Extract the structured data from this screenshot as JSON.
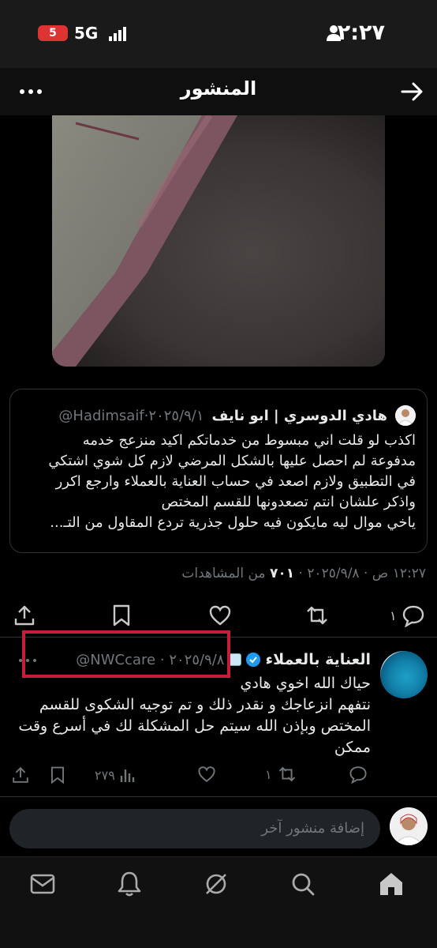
{
  "status_bar": {
    "time": "٢:٢٧",
    "network": "5G",
    "battery": "5"
  },
  "header": {
    "title": "المنشور"
  },
  "quoted_post": {
    "display_name": "هادي الدوسري | ابو نايف",
    "handle_date": "@Hadimsaif·٢٠٢٥/٩/١",
    "lines": [
      "اكذب لو قلت اني مبسوط من خدماتكم اكيد منزعج خدمه",
      "مدفوعة لم احصل عليها بالشكل المرضي لازم كل شوي اشتكي",
      "في التطبيق ولازم اصعد في حساب العناية بالعملاء وارجع اكرر",
      "واذكر علشان انتم تصعدونها للقسم المختص",
      "ياخي موال ليه مايكون فيه حلول جذرية تردع المقاول من التـ..."
    ]
  },
  "post_meta": {
    "time_date": "١٢:٢٧ ص · ٢٠٢٥/٩/٨ ·",
    "views_count": "٧٠١",
    "views_label": "من المشاهدات"
  },
  "post_actions": {
    "reply_count": "١"
  },
  "reply": {
    "display_name": "العناية بالعملاء",
    "handle_date": "@NWCcare · ٢٠٢٥/٩/٨",
    "lines": [
      "حياك الله اخوي هادي",
      "نتفهم انزعاجك و نقدر ذلك و تم توجيه الشكوى للقسم",
      "المختص وبإذن الله سيتم حل المشكلة لك في أسرع وقت",
      "ممكن"
    ],
    "reply_count": "",
    "repost_count": "١",
    "views_count": "٢٧٩"
  },
  "compose": {
    "placeholder": "إضافة منشور آخر"
  },
  "colors": {
    "background": "#000000",
    "muted": "#71767b",
    "text": "#e7e9ea",
    "verified": "#1d9bf0",
    "highlight": "#c41e3a"
  }
}
